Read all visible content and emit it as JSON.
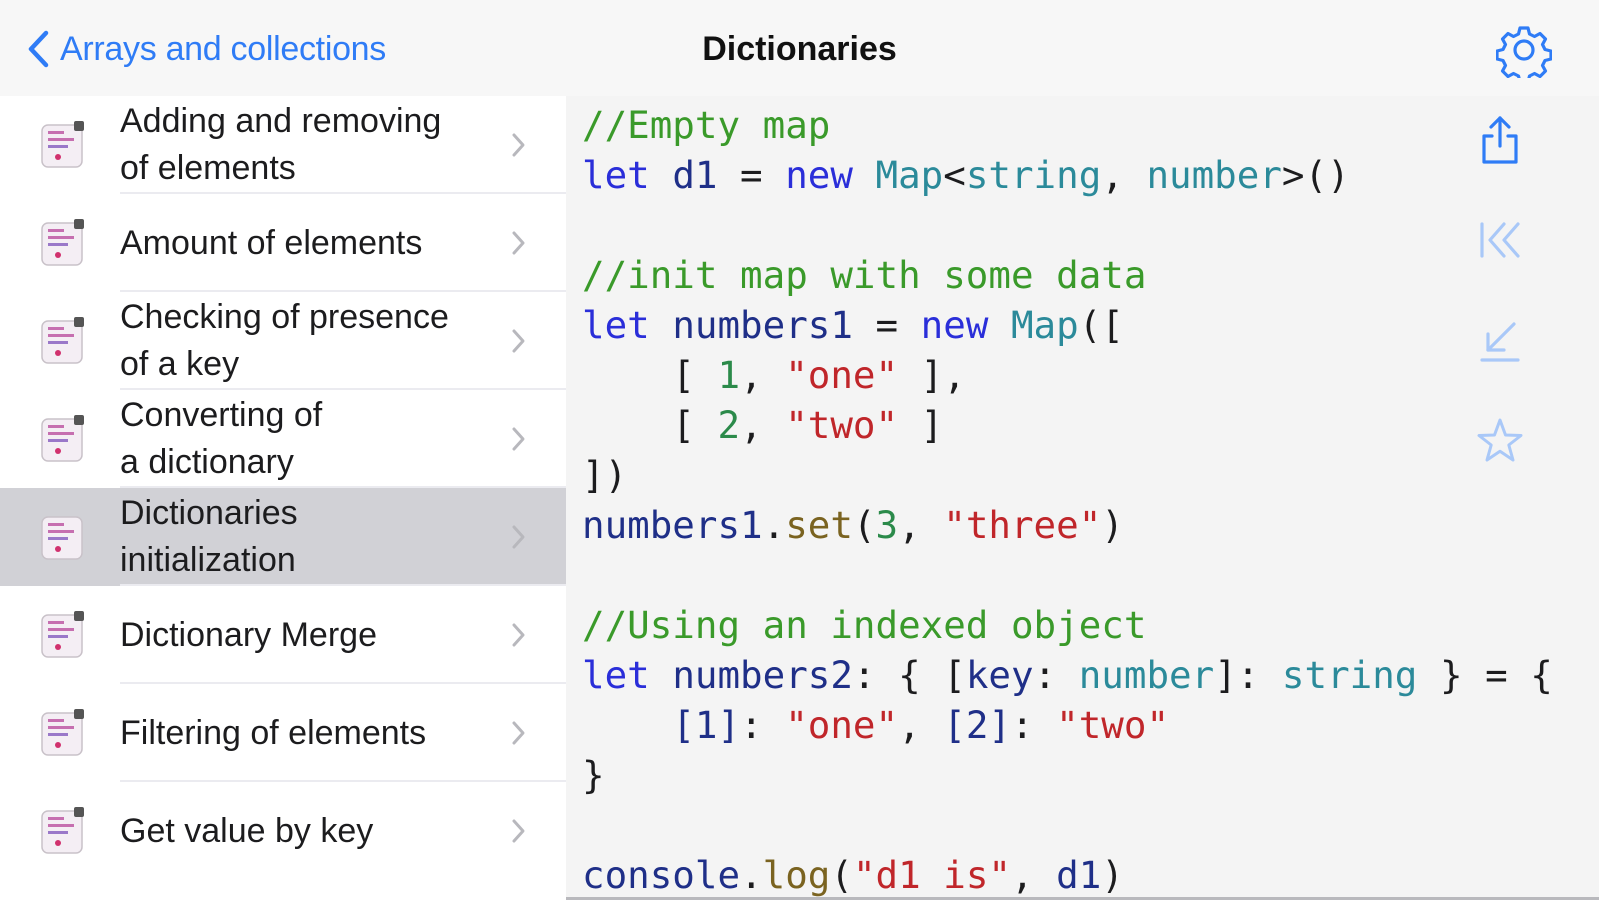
{
  "nav": {
    "back_label": "Arrays and collections",
    "title": "Dictionaries"
  },
  "sidebar": {
    "items": [
      {
        "label": "Adding and removing\nof elements"
      },
      {
        "label": "Amount of elements"
      },
      {
        "label": "Checking of presence\nof a key"
      },
      {
        "label": "Converting of\na dictionary"
      },
      {
        "label": "Dictionaries\ninitialization",
        "selected": true
      },
      {
        "label": "Dictionary Merge"
      },
      {
        "label": "Filtering of elements"
      },
      {
        "label": "Get value by key"
      }
    ]
  },
  "code_lines": [
    [
      {
        "t": "//Empty map",
        "c": "cm"
      }
    ],
    [
      {
        "t": "let",
        "c": "kw"
      },
      {
        "t": " "
      },
      {
        "t": "d1",
        "c": "id"
      },
      {
        "t": " = "
      },
      {
        "t": "new",
        "c": "kw"
      },
      {
        "t": " "
      },
      {
        "t": "Map",
        "c": "ty"
      },
      {
        "t": "<"
      },
      {
        "t": "string",
        "c": "ty"
      },
      {
        "t": ", "
      },
      {
        "t": "number",
        "c": "ty"
      },
      {
        "t": ">()"
      }
    ],
    [],
    [
      {
        "t": "//init map with some data",
        "c": "cm"
      }
    ],
    [
      {
        "t": "let",
        "c": "kw"
      },
      {
        "t": " "
      },
      {
        "t": "numbers1",
        "c": "id"
      },
      {
        "t": " = "
      },
      {
        "t": "new",
        "c": "kw"
      },
      {
        "t": " "
      },
      {
        "t": "Map",
        "c": "ty"
      },
      {
        "t": "(["
      }
    ],
    [
      {
        "t": "    [ "
      },
      {
        "t": "1",
        "c": "num"
      },
      {
        "t": ", "
      },
      {
        "t": "\"one\"",
        "c": "str"
      },
      {
        "t": " ],"
      }
    ],
    [
      {
        "t": "    [ "
      },
      {
        "t": "2",
        "c": "num"
      },
      {
        "t": ", "
      },
      {
        "t": "\"two\"",
        "c": "str"
      },
      {
        "t": " ]"
      }
    ],
    [
      {
        "t": "])"
      }
    ],
    [
      {
        "t": "numbers1",
        "c": "id"
      },
      {
        "t": "."
      },
      {
        "t": "set",
        "c": "fn"
      },
      {
        "t": "("
      },
      {
        "t": "3",
        "c": "num"
      },
      {
        "t": ", "
      },
      {
        "t": "\"three\"",
        "c": "str"
      },
      {
        "t": ")"
      }
    ],
    [],
    [
      {
        "t": "//Using an indexed object",
        "c": "cm"
      }
    ],
    [
      {
        "t": "let",
        "c": "kw"
      },
      {
        "t": " "
      },
      {
        "t": "numbers2",
        "c": "id"
      },
      {
        "t": ": { ["
      },
      {
        "t": "key",
        "c": "id"
      },
      {
        "t": ": "
      },
      {
        "t": "number",
        "c": "ty"
      },
      {
        "t": "]: "
      },
      {
        "t": "string",
        "c": "ty"
      },
      {
        "t": " } = {"
      }
    ],
    [
      {
        "t": "    "
      },
      {
        "t": "[1]",
        "c": "id"
      },
      {
        "t": ": "
      },
      {
        "t": "\"one\"",
        "c": "str"
      },
      {
        "t": ", "
      },
      {
        "t": "[2]",
        "c": "id"
      },
      {
        "t": ": "
      },
      {
        "t": "\"two\"",
        "c": "str"
      }
    ],
    [
      {
        "t": "}"
      }
    ],
    [],
    [
      {
        "t": "console",
        "c": "id"
      },
      {
        "t": "."
      },
      {
        "t": "log",
        "c": "fn"
      },
      {
        "t": "("
      },
      {
        "t": "\"d1 is\"",
        "c": "str"
      },
      {
        "t": ", "
      },
      {
        "t": "d1",
        "c": "id"
      },
      {
        "t": ")"
      }
    ]
  ],
  "toolbar": {
    "icons": [
      "share-icon",
      "first-page-icon",
      "download-icon",
      "favorite-star-icon"
    ]
  },
  "colors": {
    "accent": "#2f7cf6",
    "comment": "#3a9a2a",
    "keyword": "#2a2ed9",
    "type": "#2b8a9a",
    "string": "#c0262a",
    "number": "#2b8a4a",
    "selected_row": "#d1d1d6"
  }
}
